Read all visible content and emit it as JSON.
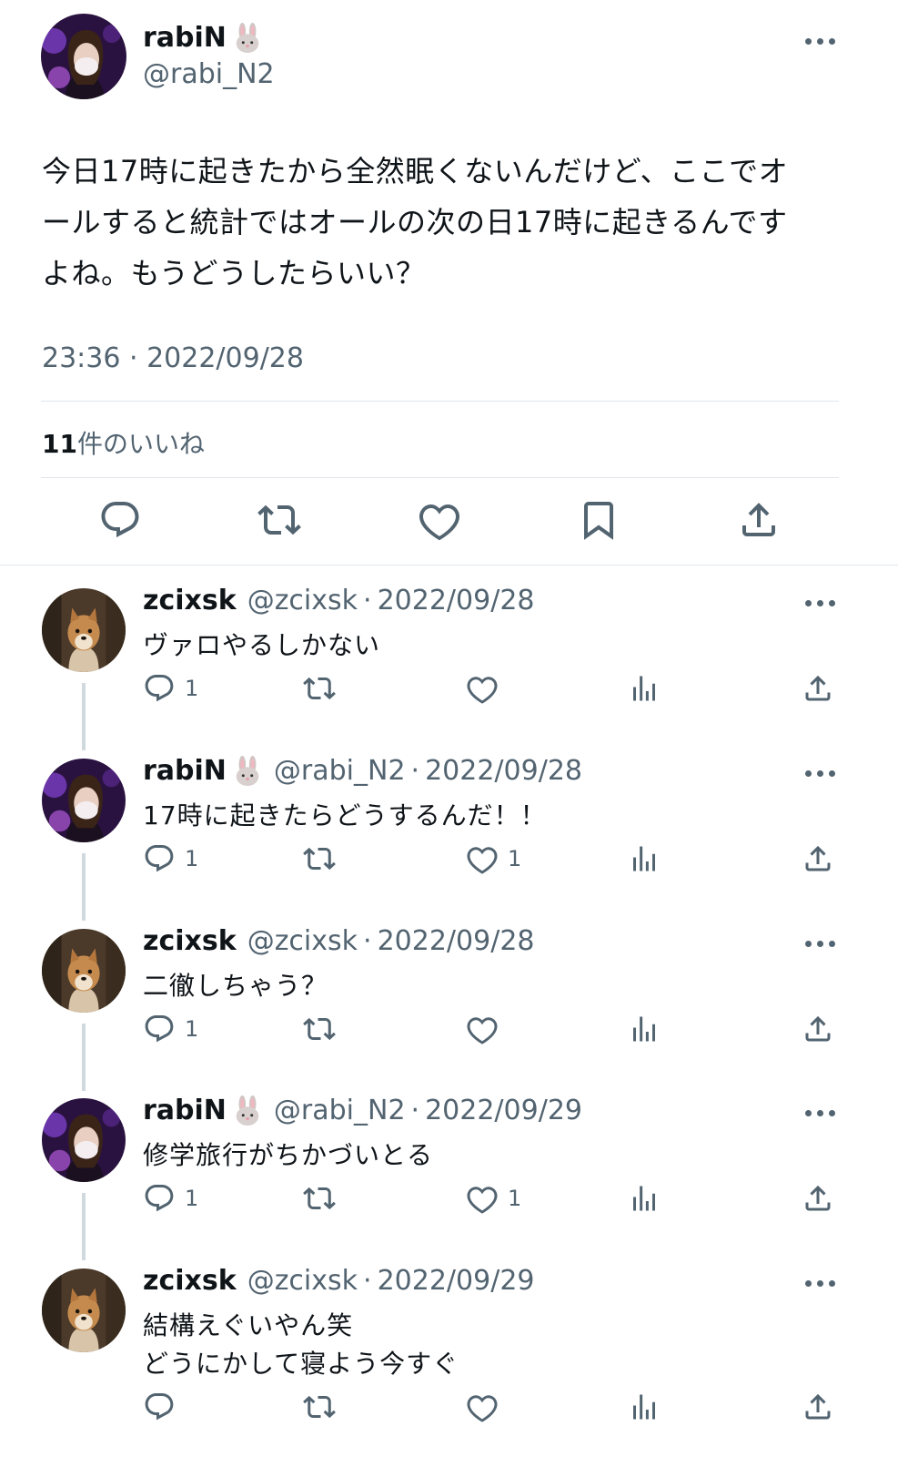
{
  "main_tweet": {
    "display_name": "rabiN",
    "handle": "@rabi_N2",
    "text_lines": [
      "今日17時に起きたから全然眠くないんだけど、ここでオ",
      "ールすると統計ではオールの次の日17時に起きるんです",
      "よね。もうどうしたらいい？"
    ],
    "timestamp": "23:36 · 2022/09/28",
    "like_count": "11",
    "like_label": "件のいいね",
    "actions": [
      "reply-icon",
      "retweet-icon",
      "heart-icon",
      "bookmark-icon",
      "share-icon"
    ]
  },
  "replies": [
    {
      "display_name": "zcixsk",
      "handle": "@zcixsk",
      "date": "2022/09/28",
      "text_lines": [
        "ヴァロやるしかない"
      ],
      "reply_count": "1",
      "like_count": "",
      "avatar": "dog"
    },
    {
      "display_name": "rabiN",
      "handle": "@rabi_N2",
      "date": "2022/09/28",
      "text_lines": [
        "17時に起きたらどうするんだ！！"
      ],
      "reply_count": "1",
      "like_count": "1",
      "avatar": "girl"
    },
    {
      "display_name": "zcixsk",
      "handle": "@zcixsk",
      "date": "2022/09/28",
      "text_lines": [
        "二徹しちゃう？"
      ],
      "reply_count": "1",
      "like_count": "",
      "avatar": "dog"
    },
    {
      "display_name": "rabiN",
      "handle": "@rabi_N2",
      "date": "2022/09/29",
      "text_lines": [
        "修学旅行がちかづいとる"
      ],
      "reply_count": "1",
      "like_count": "1",
      "avatar": "girl"
    },
    {
      "display_name": "zcixsk",
      "handle": "@zcixsk",
      "date": "2022/09/29",
      "text_lines": [
        "結構えぐいやん笑",
        "どうにかして寝よう今すぐ"
      ],
      "reply_count": "",
      "like_count": "",
      "avatar": "dog"
    }
  ],
  "colors": {
    "text": "#0f1419",
    "secondary": "#536471",
    "divider": "#e1e6ea",
    "thread_line": "#cfd9de"
  }
}
